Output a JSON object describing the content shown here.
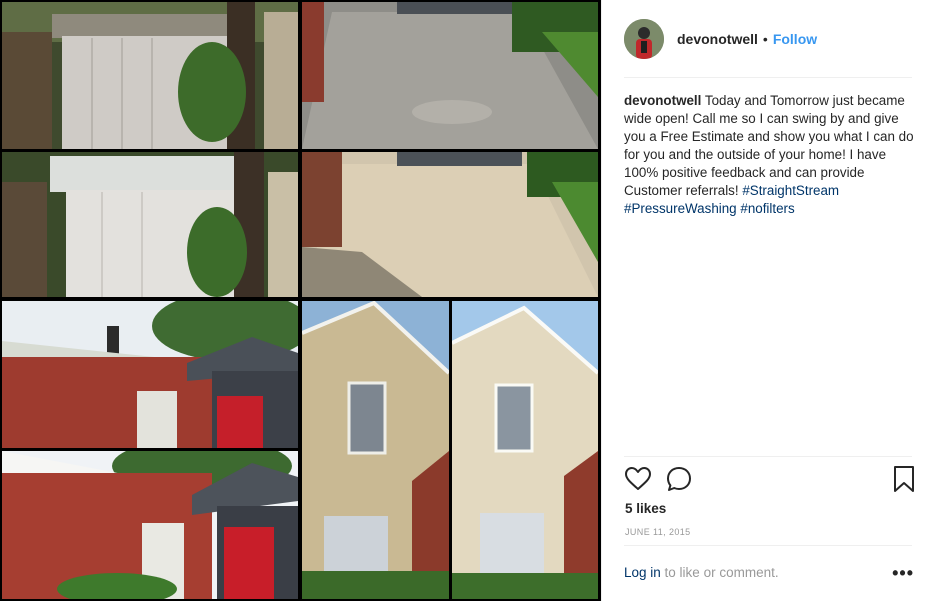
{
  "post": {
    "username": "devonotwell",
    "separator": "•",
    "follow_label": "Follow",
    "caption_user": "devonotwell",
    "caption_text": "Today and Tomorrow just became wide open! Call me so I can swing by and give you a Free Estimate and show you what I can do for you and the outside of your home! I have 100% positive feedback and can provide Customer referrals!",
    "hashtags": [
      "#StraightStream",
      "#PressureWashing",
      "#nofilters"
    ],
    "likes": "5 likes",
    "date": "JUNE 11, 2015",
    "login_link": "Log in",
    "login_suffix": " to like or comment.",
    "more_label": "•••"
  },
  "icons": {
    "heart": "heart-icon",
    "comment": "comment-icon",
    "bookmark": "bookmark-icon"
  },
  "colors": {
    "link_blue": "#3897f0",
    "hashtag_blue": "#003569",
    "muted_gray": "#999999",
    "text": "#262626"
  }
}
